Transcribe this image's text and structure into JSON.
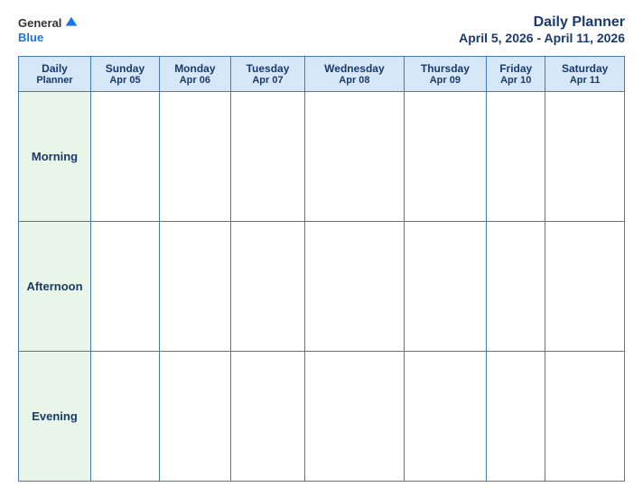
{
  "header": {
    "logo": {
      "general": "General",
      "blue": "Blue",
      "icon_color": "#1a73e8"
    },
    "title": "Daily Planner",
    "date_range": "April 5, 2026 - April 11, 2026"
  },
  "table": {
    "header_label_line1": "Daily",
    "header_label_line2": "Planner",
    "days": [
      {
        "name": "Sunday",
        "date": "Apr 05"
      },
      {
        "name": "Monday",
        "date": "Apr 06"
      },
      {
        "name": "Tuesday",
        "date": "Apr 07"
      },
      {
        "name": "Wednesday",
        "date": "Apr 08"
      },
      {
        "name": "Thursday",
        "date": "Apr 09"
      },
      {
        "name": "Friday",
        "date": "Apr 10"
      },
      {
        "name": "Saturday",
        "date": "Apr 11"
      }
    ],
    "rows": [
      {
        "label": "Morning"
      },
      {
        "label": "Afternoon"
      },
      {
        "label": "Evening"
      }
    ]
  }
}
